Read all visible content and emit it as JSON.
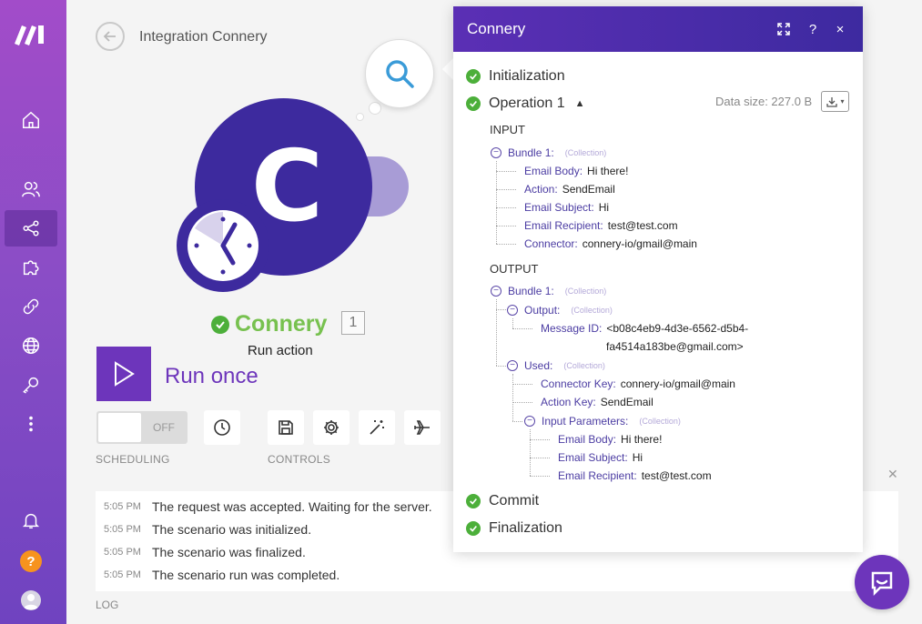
{
  "scenario": {
    "title": "Integration Connery"
  },
  "node": {
    "name": "Connery",
    "letter": "C",
    "count": "1",
    "subtitle": "Run action"
  },
  "toolbar": {
    "run_label": "Run once",
    "toggle_text": "OFF",
    "scheduling_label": "SCHEDULING",
    "controls_label": "CONTROLS"
  },
  "log": {
    "label": "LOG",
    "entries": [
      {
        "time": "5:05 PM",
        "message": "The request was accepted. Waiting for the server."
      },
      {
        "time": "5:05 PM",
        "message": "The scenario was initialized."
      },
      {
        "time": "5:05 PM",
        "message": "The scenario was finalized."
      },
      {
        "time": "5:05 PM",
        "message": "The scenario run was completed."
      }
    ]
  },
  "panel": {
    "title": "Connery",
    "help_icon": "?",
    "close_icon": "×",
    "steps": {
      "initialization": "Initialization",
      "operation": "Operation 1",
      "commit": "Commit",
      "finalization": "Finalization"
    },
    "data_size": "Data size: 227.0 B",
    "input_label": "INPUT",
    "output_label": "OUTPUT",
    "collection_tag": "(Collection)",
    "input": {
      "bundle": "Bundle 1",
      "fields": [
        {
          "key": "Email Body",
          "value": "Hi there!"
        },
        {
          "key": "Action",
          "value": "SendEmail"
        },
        {
          "key": "Email Subject",
          "value": "Hi"
        },
        {
          "key": "Email Recipient",
          "value": "test@test.com"
        },
        {
          "key": "Connector",
          "value": "connery-io/gmail@main"
        }
      ]
    },
    "output": {
      "bundle": "Bundle 1",
      "output_key": "Output",
      "message_id_key": "Message ID",
      "message_id_line1": "<b08c4eb9-4d3e-6562-d5b4-",
      "message_id_line2": "fa4514a183be@gmail.com>",
      "used_key": "Used",
      "connector_key_key": "Connector Key",
      "connector_key_value": "connery-io/gmail@main",
      "action_key_key": "Action Key",
      "action_key_value": "SendEmail",
      "input_params_key": "Input Parameters",
      "params": [
        {
          "key": "Email Body",
          "value": "Hi there!"
        },
        {
          "key": "Email Subject",
          "value": "Hi"
        },
        {
          "key": "Email Recipient",
          "value": "test@test.com"
        }
      ]
    }
  },
  "sidebar": {
    "items": [
      "home-icon",
      "team-icon",
      "scenarios-icon",
      "apps-icon",
      "connections-icon",
      "webhooks-icon",
      "keys-icon",
      "more-icon",
      "notifications-icon",
      "help-icon",
      "avatar"
    ],
    "help_text": "?"
  },
  "colors": {
    "accent": "#6d35bb",
    "success": "#4caf3a",
    "node": "#3d2a9e"
  }
}
